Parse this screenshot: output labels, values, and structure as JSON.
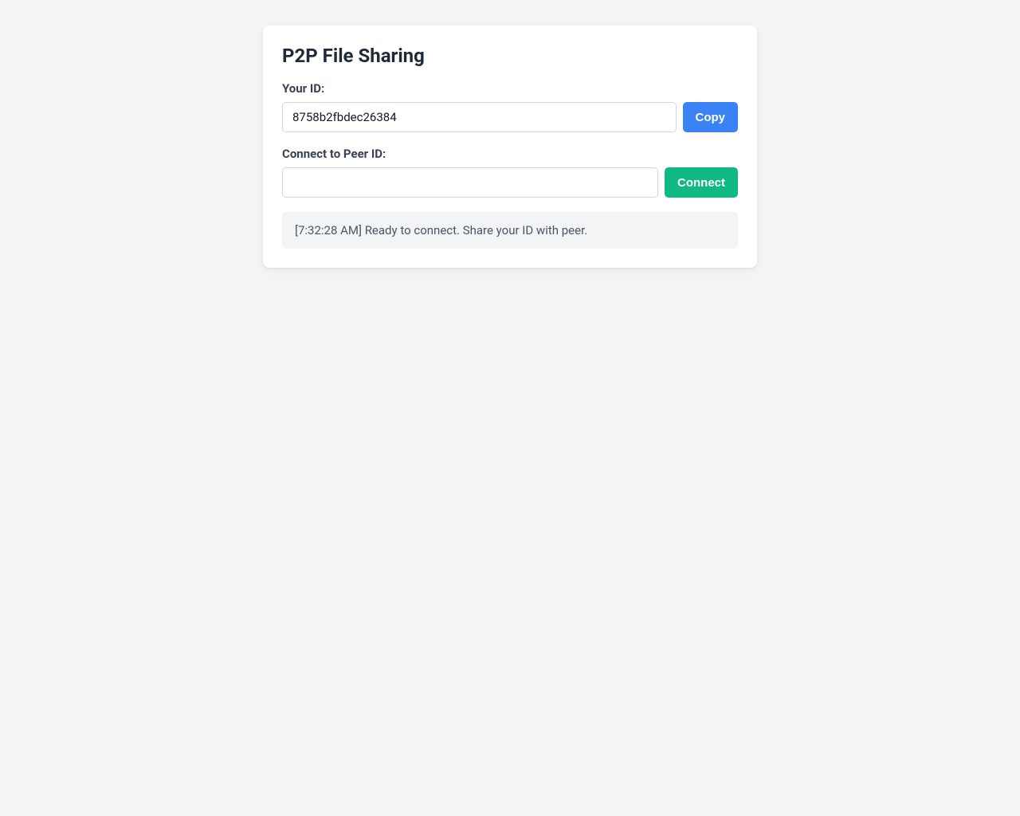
{
  "title": "P2P File Sharing",
  "your_id": {
    "label": "Your ID:",
    "value": "8758b2fbdec26384",
    "copy_label": "Copy"
  },
  "connect": {
    "label": "Connect to Peer ID:",
    "value": "",
    "button_label": "Connect"
  },
  "log": {
    "entry": "[7:32:28 AM] Ready to connect. Share your ID with peer."
  }
}
